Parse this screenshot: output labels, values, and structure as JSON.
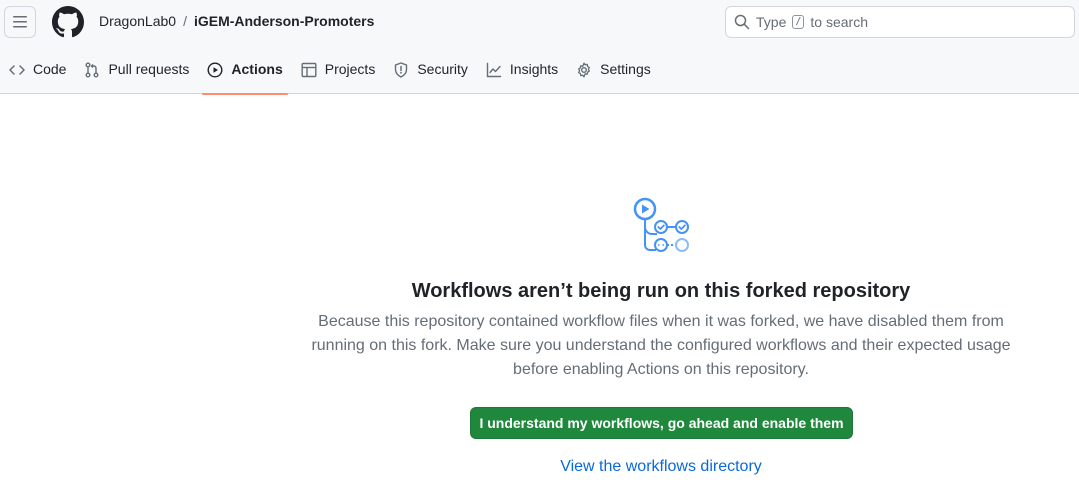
{
  "header": {
    "owner": "DragonLab0",
    "separator": "/",
    "repo": "iGEM-Anderson-Promoters",
    "search_placeholder_prefix": "Type",
    "search_key": "/",
    "search_placeholder_suffix": "to search"
  },
  "tabs": [
    {
      "label": "Code",
      "icon": "code-icon",
      "active": false
    },
    {
      "label": "Pull requests",
      "icon": "pull-request-icon",
      "active": false
    },
    {
      "label": "Actions",
      "icon": "play-icon",
      "active": true
    },
    {
      "label": "Projects",
      "icon": "table-icon",
      "active": false
    },
    {
      "label": "Security",
      "icon": "shield-icon",
      "active": false
    },
    {
      "label": "Insights",
      "icon": "graph-icon",
      "active": false
    },
    {
      "label": "Settings",
      "icon": "gear-icon",
      "active": false
    }
  ],
  "main": {
    "heading": "Workflows aren’t being run on this forked repository",
    "description": "Because this repository contained workflow files when it was forked, we have disabled them from running on this fork. Make sure you understand the configured workflows and their expected usage before enabling Actions on this repository.",
    "enable_button": "I understand my workflows, go ahead and enable them",
    "view_link": "View the workflows directory"
  },
  "colors": {
    "accent_green": "#1f883d",
    "link_blue": "#0969da",
    "active_tab_underline": "#fd8c73",
    "icon_blue": "#4493f8"
  }
}
